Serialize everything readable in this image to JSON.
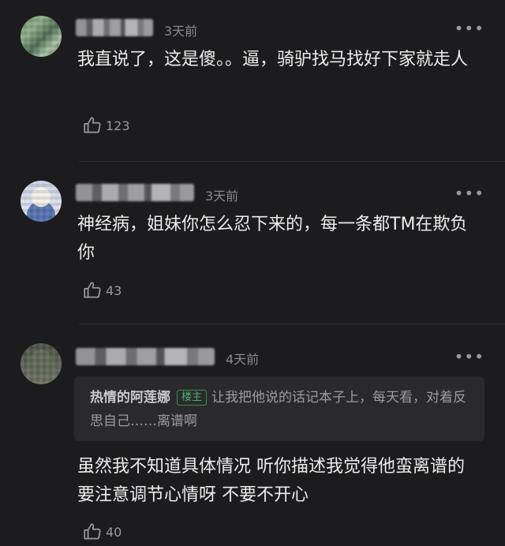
{
  "comments": [
    {
      "time": "3天前",
      "text": "我直说了，这是傻。。逼，骑驴找马找好下家就走人",
      "likes": "123",
      "more_icon": "more-dots-icon",
      "avatar": "blurred-avatar"
    },
    {
      "time": "3天前",
      "text": "神经病，姐妹你怎么忍下来的，每一条都TM在欺负你",
      "likes": "43",
      "more_icon": "more-dots-icon",
      "avatar": "blurred-avatar"
    },
    {
      "time": "4天前",
      "quote": {
        "author": "热情的阿莲娜",
        "badge": "楼主",
        "text": "让我把他说的话记本子上，每天看，对着反思自己……离谱啊"
      },
      "text": "虽然我不知道具体情况 听你描述我觉得他蛮离谱的 要注意调节心情呀 不要不开心",
      "likes": "40",
      "more_icon": "more-dots-icon",
      "avatar": "blurred-avatar"
    }
  ],
  "colors": {
    "background": "#1c1c1e",
    "text": "#ececec",
    "muted": "#8a8a8e",
    "badge": "#4fae6c"
  }
}
